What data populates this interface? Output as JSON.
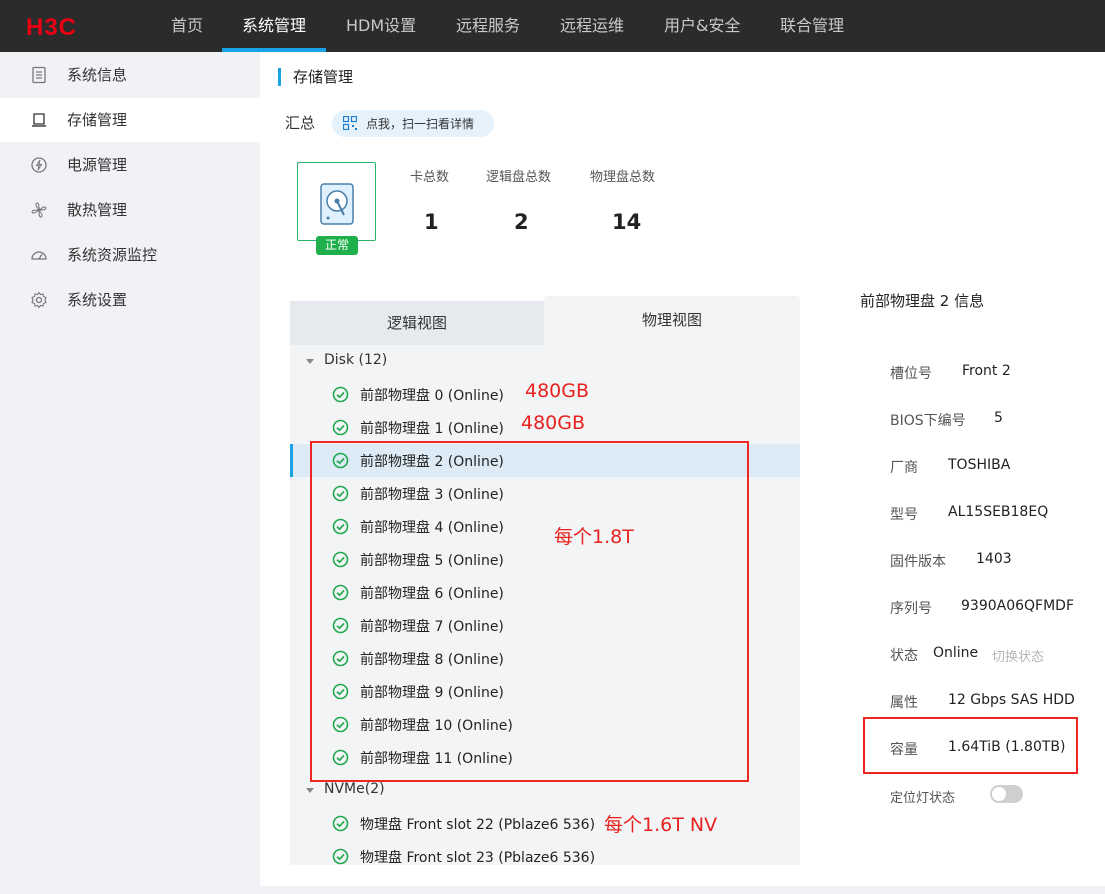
{
  "brand": {
    "logo_text": "H3C",
    "color": "#e60012"
  },
  "nav": {
    "items": [
      {
        "label": "首页",
        "active": false
      },
      {
        "label": "系统管理",
        "active": true
      },
      {
        "label": "HDM设置",
        "active": false
      },
      {
        "label": "远程服务",
        "active": false
      },
      {
        "label": "远程运维",
        "active": false
      },
      {
        "label": "用户&安全",
        "active": false
      },
      {
        "label": "联合管理",
        "active": false
      }
    ],
    "accent": "#1aa2e6"
  },
  "sidebar": {
    "items": [
      {
        "label": "系统信息",
        "icon": "document-icon",
        "active": false
      },
      {
        "label": "存储管理",
        "icon": "storage-icon",
        "active": true
      },
      {
        "label": "电源管理",
        "icon": "power-icon",
        "active": false
      },
      {
        "label": "散热管理",
        "icon": "fan-icon",
        "active": false
      },
      {
        "label": "系统资源监控",
        "icon": "gauge-icon",
        "active": false
      },
      {
        "label": "系统设置",
        "icon": "gear-icon",
        "active": false
      }
    ]
  },
  "page": {
    "title": "存储管理",
    "summary_label": "汇总",
    "scan_hint": "点我，扫一扫看详情",
    "status": "正常",
    "stats": [
      {
        "label": "卡总数",
        "value": "1"
      },
      {
        "label": "逻辑盘总数",
        "value": "2"
      },
      {
        "label": "物理盘总数",
        "value": "14"
      }
    ]
  },
  "tabs": [
    {
      "label": "逻辑视图",
      "active": false
    },
    {
      "label": "物理视图",
      "active": true
    }
  ],
  "tree": {
    "disk_group": "Disk (12)",
    "disks": [
      "前部物理盘 0 (Online)",
      "前部物理盘 1 (Online)",
      "前部物理盘 2 (Online)",
      "前部物理盘 3 (Online)",
      "前部物理盘 4 (Online)",
      "前部物理盘 5 (Online)",
      "前部物理盘 6 (Online)",
      "前部物理盘 7 (Online)",
      "前部物理盘 8 (Online)",
      "前部物理盘 9 (Online)",
      "前部物理盘 10 (Online)",
      "前部物理盘 11 (Online)"
    ],
    "selected_index": 2,
    "nvme_group": "NVMe(2)",
    "nvme": [
      "物理盘 Front slot 22 (Pblaze6 536)",
      "物理盘 Front slot 23 (Pblaze6 536)"
    ]
  },
  "annotations": {
    "disk0": "480GB",
    "disk1": "480GB",
    "group": "每个1.8T",
    "nvme": "每个1.6T NV",
    "color": "#e8221e"
  },
  "detail": {
    "title": "前部物理盘 2 信息",
    "fields": [
      {
        "label": "槽位号",
        "value": "Front 2"
      },
      {
        "label": "BIOS下编号",
        "value": "5"
      },
      {
        "label": "厂商",
        "value": "TOSHIBA"
      },
      {
        "label": "型号",
        "value": "AL15SEB18EQ"
      },
      {
        "label": "固件版本",
        "value": "1403"
      },
      {
        "label": "序列号",
        "value": "9390A06QFMDF"
      },
      {
        "label": "状态",
        "value": "Online"
      },
      {
        "label": "属性",
        "value": "12 Gbps SAS HDD"
      },
      {
        "label": "容量",
        "value": "1.64TiB (1.80TB)"
      },
      {
        "label": "定位灯状态",
        "value": ""
      }
    ],
    "switch_state_link": "切换状态",
    "locate_led_on": false
  }
}
